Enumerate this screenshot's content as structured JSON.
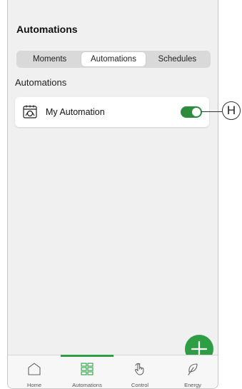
{
  "header": {
    "title": "Automations"
  },
  "segments": [
    {
      "label": "Moments",
      "active": false
    },
    {
      "label": "Automations",
      "active": true
    },
    {
      "label": "Schedules",
      "active": false
    }
  ],
  "section": {
    "title": "Automations"
  },
  "automations": [
    {
      "label": "My Automation",
      "icon": "automation-icon",
      "enabled": true
    }
  ],
  "callout": {
    "label": "H"
  },
  "fab": {
    "icon": "plus-icon"
  },
  "tabbar": {
    "items": [
      {
        "label": "Home",
        "icon": "home-icon",
        "active": false
      },
      {
        "label": "Automations",
        "icon": "grid-icon",
        "active": true
      },
      {
        "label": "Control",
        "icon": "hand-icon",
        "active": false
      },
      {
        "label": "Energy",
        "icon": "leaf-icon",
        "active": false
      }
    ]
  },
  "colors": {
    "accent": "#2e9e44",
    "toggle_on": "#2e8b3c",
    "background": "#f0f0f0"
  }
}
